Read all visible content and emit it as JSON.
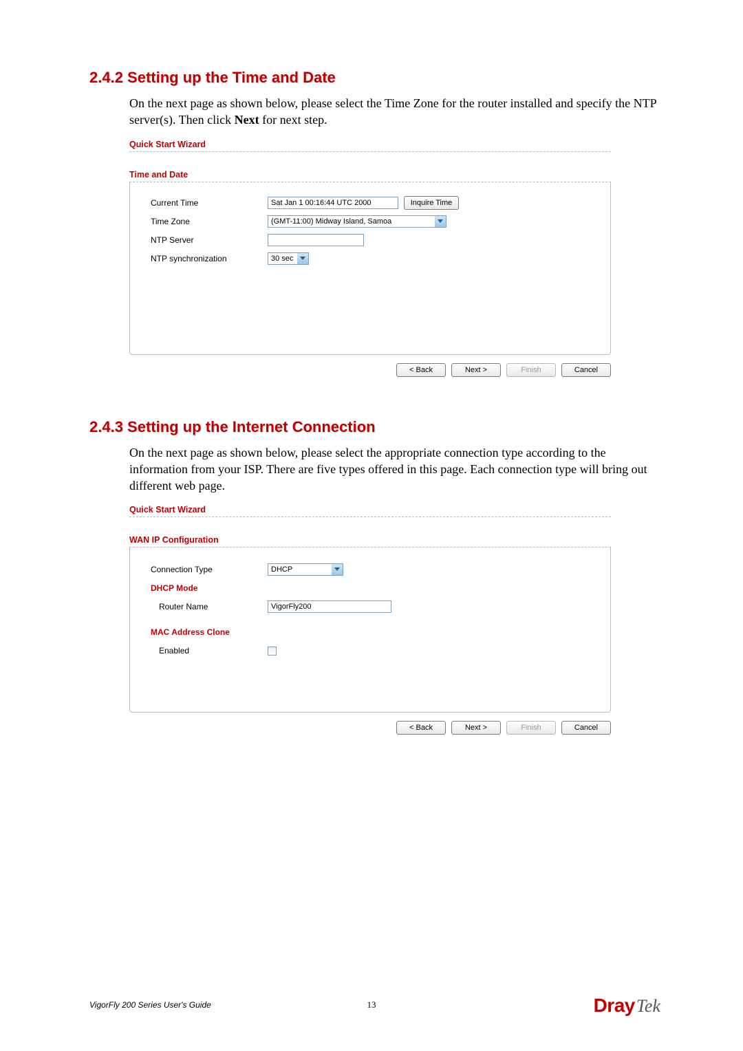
{
  "section1": {
    "heading": "2.4.2 Setting up the Time and Date",
    "para_a": "On the next page as shown below, please select the Time Zone for the router installed and specify the NTP server(s). Then click ",
    "para_bold": "Next",
    "para_b": " for next step."
  },
  "wizard1": {
    "title": "Quick Start Wizard",
    "subtitle": "Time and Date",
    "rows": {
      "current_time_label": "Current Time",
      "current_time_value": "Sat Jan  1 00:16:44 UTC 2000",
      "inquire_btn": "Inquire Time",
      "time_zone_label": "Time Zone",
      "time_zone_value": "(GMT-11:00) Midway Island, Samoa",
      "ntp_server_label": "NTP Server",
      "ntp_server_value": "",
      "ntp_sync_label": "NTP synchronization",
      "ntp_sync_value": "30 sec"
    },
    "buttons": {
      "back": "< Back",
      "next": "Next >",
      "finish": "Finish",
      "cancel": "Cancel"
    }
  },
  "section2": {
    "heading": "2.4.3 Setting up the Internet Connection",
    "para": "On the next page as shown below, please select the appropriate connection type according to the information from your ISP. There are five types offered in this page. Each connection type will bring out different web page."
  },
  "wizard2": {
    "title": "Quick Start Wizard",
    "subtitle": "WAN IP Configuration",
    "rows": {
      "conn_type_label": "Connection Type",
      "conn_type_value": "DHCP",
      "dhcp_mode_label": "DHCP Mode",
      "router_name_label": "Router Name",
      "router_name_value": "VigorFly200",
      "mac_clone_label": "MAC Address Clone",
      "enabled_label": "Enabled"
    },
    "buttons": {
      "back": "< Back",
      "next": "Next >",
      "finish": "Finish",
      "cancel": "Cancel"
    }
  },
  "footer": {
    "guide": "VigorFly 200 Series User's Guide",
    "page": "13",
    "brand_dray": "Dray",
    "brand_tek": "Tek"
  }
}
